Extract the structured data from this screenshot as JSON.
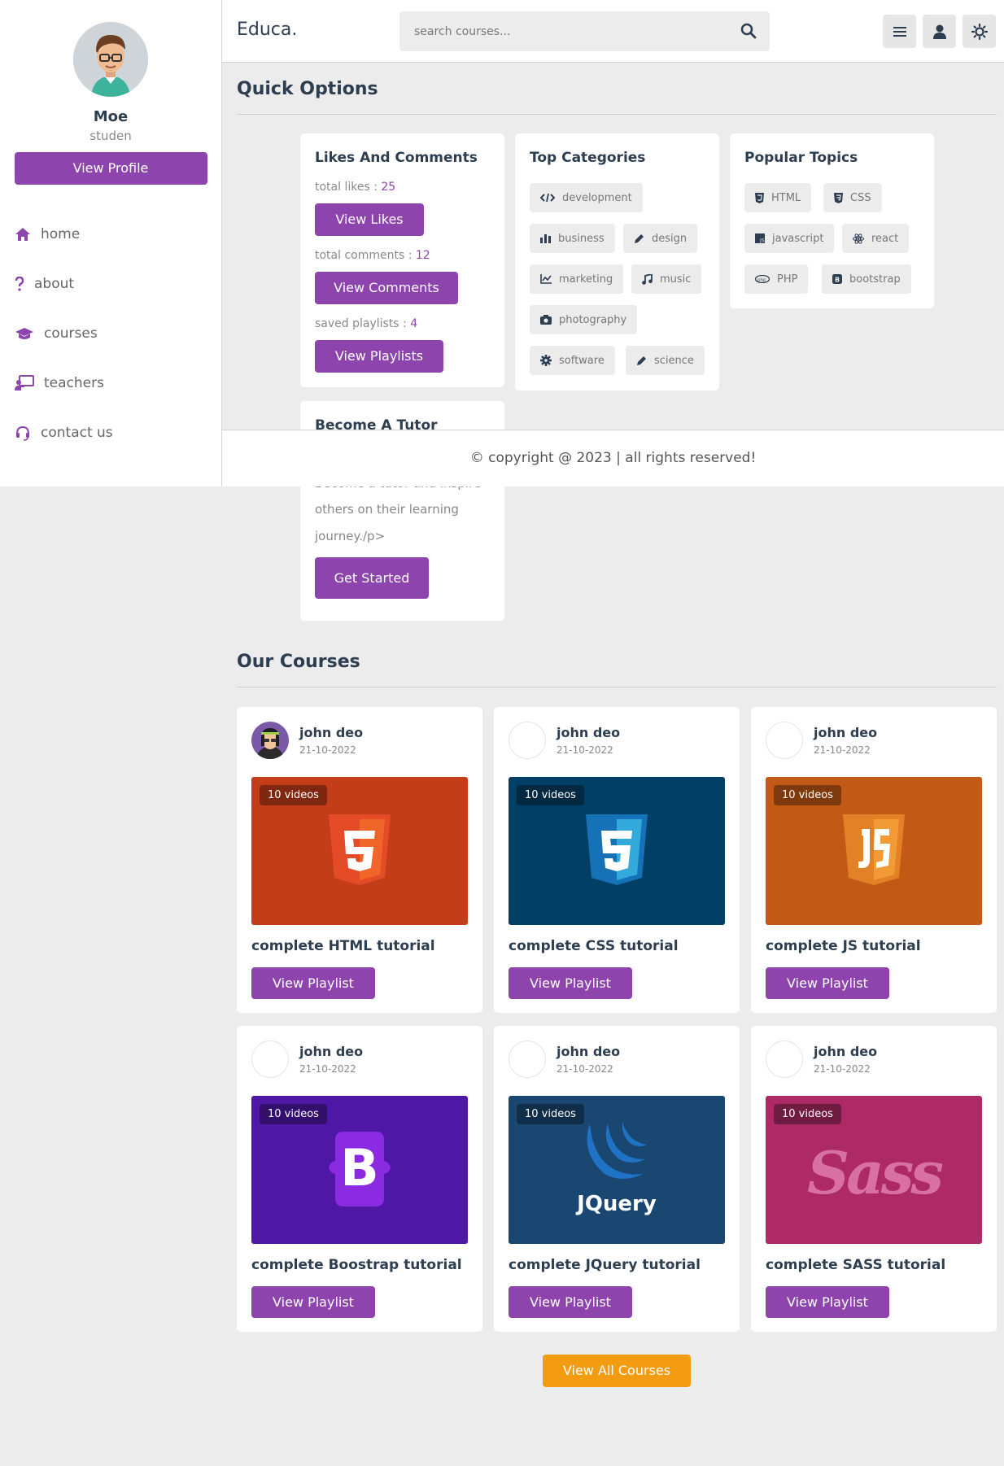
{
  "profile": {
    "name": "Moe",
    "role": "studen",
    "button": "View Profile"
  },
  "nav": [
    {
      "label": "home",
      "icon": "home-icon"
    },
    {
      "label": "about",
      "icon": "question-icon"
    },
    {
      "label": "courses",
      "icon": "graduation-cap-icon"
    },
    {
      "label": "teachers",
      "icon": "chalkboard-teacher-icon"
    },
    {
      "label": "contact us",
      "icon": "headset-icon"
    }
  ],
  "header": {
    "logo": "Educa.",
    "search_placeholder": "search courses..."
  },
  "quick": {
    "title": "Quick Options",
    "likes": {
      "title": "Likes And Comments",
      "likes_label": "total likes : ",
      "likes_value": "25",
      "likes_btn": "View Likes",
      "comments_label": "total comments : ",
      "comments_value": "12",
      "comments_btn": "View Comments",
      "playlists_label": "saved playlists : ",
      "playlists_value": "4",
      "playlists_btn": "View Playlists"
    },
    "categories": {
      "title": "Top Categories",
      "items": [
        "development",
        "business",
        "design",
        "marketing",
        "music",
        "photography",
        "software",
        "science"
      ]
    },
    "topics": {
      "title": "Popular Topics",
      "items": [
        "HTML",
        "CSS",
        "javascript",
        "react",
        "PHP",
        "bootstrap"
      ]
    },
    "tutor": {
      "title": "Become A Tutor",
      "text_partial": "Become a tutor and inspire",
      "text_line2": "others on their learning",
      "text_line3": "journey./p>",
      "button": "Get Started"
    }
  },
  "footer": {
    "text": "© copyright @ 2023 | all rights reserved!"
  },
  "courses": {
    "title": "Our Courses",
    "items": [
      {
        "author": "john deo",
        "date": "21-10-2022",
        "badge": "10 videos",
        "title": "complete HTML tutorial",
        "button": "View Playlist",
        "color": "#c43d19"
      },
      {
        "author": "john deo",
        "date": "21-10-2022",
        "badge": "10 videos",
        "title": "complete CSS tutorial",
        "button": "View Playlist",
        "color": "#023f66"
      },
      {
        "author": "john deo",
        "date": "21-10-2022",
        "badge": "10 videos",
        "title": "complete JS tutorial",
        "button": "View Playlist",
        "color": "#c25914"
      },
      {
        "author": "john deo",
        "date": "21-10-2022",
        "badge": "10 videos",
        "title": "complete Boostrap tutorial",
        "button": "View Playlist",
        "color": "#4f17a6"
      },
      {
        "author": "john deo",
        "date": "21-10-2022",
        "badge": "10 videos",
        "title": "complete JQuery tutorial",
        "button": "View Playlist",
        "color": "#1a4772",
        "logo_text": "JQuery"
      },
      {
        "author": "john deo",
        "date": "21-10-2022",
        "badge": "10 videos",
        "title": "complete SASS tutorial",
        "button": "View Playlist",
        "color": "#ad2a66",
        "logo_text": "Sass"
      }
    ],
    "view_all": "View All Courses"
  },
  "colors": {
    "accent": "#8e44ad",
    "orange": "#f39c12",
    "text": "#2c3e50"
  }
}
